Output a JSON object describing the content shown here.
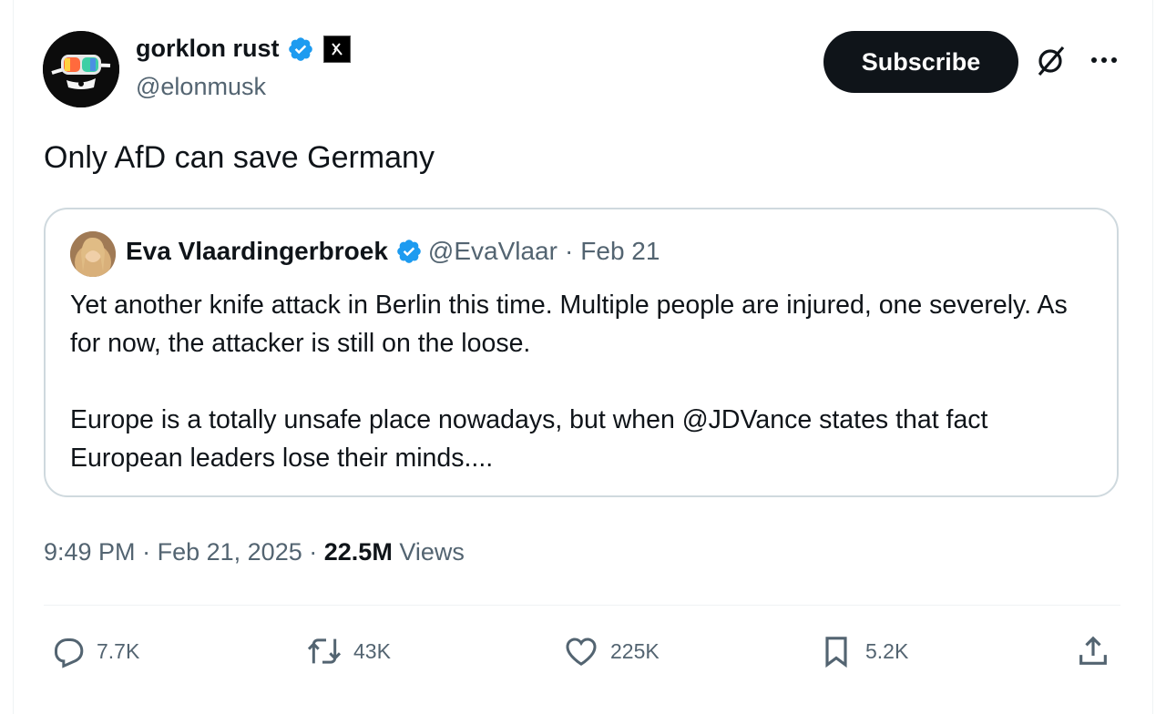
{
  "author": {
    "name": "gorklon rust",
    "handle": "@elonmusk",
    "avatar_icon": "goggles-avatar",
    "verified_color": "#1d9bf0"
  },
  "header": {
    "subscribe_label": "Subscribe"
  },
  "post": {
    "text": "Only AfD can save Germany"
  },
  "quoted": {
    "name": "Eva Vlaardingerbroek",
    "handle": "@EvaVlaar",
    "separator": "·",
    "date": "Feb 21",
    "paragraphs": [
      "Yet another knife attack in Berlin this time. Multiple people are injured, one severely. As for now, the attacker is still on the loose.",
      "Europe is a totally unsafe place nowadays, but when @JDVance states that fact European leaders lose their minds...."
    ]
  },
  "meta": {
    "time": "9:49 PM",
    "sep": "·",
    "date": "Feb 21, 2025",
    "views_count": "22.5M",
    "views_label": "Views"
  },
  "actions": {
    "replies": "7.7K",
    "reposts": "43K",
    "likes": "225K",
    "bookmarks": "5.2K"
  },
  "colors": {
    "text": "#0f1419",
    "secondary": "#536471",
    "border": "#cfd9de",
    "verified": "#1d9bf0",
    "subscribe_bg": "#0f1419"
  }
}
